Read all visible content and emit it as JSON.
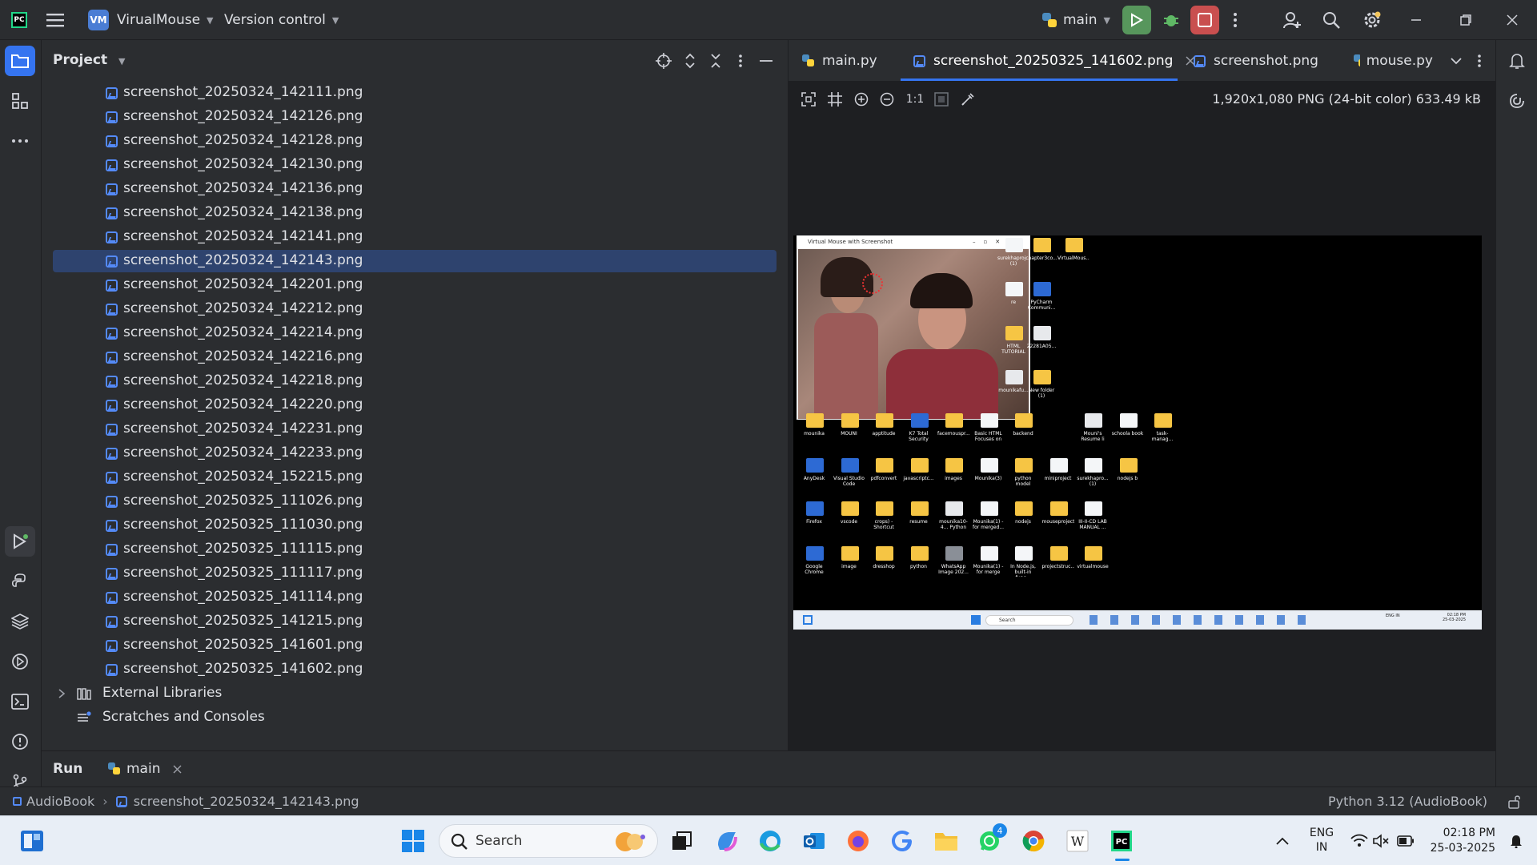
{
  "titlebar": {
    "project_badge": "VM",
    "project_name": "VirualMouse",
    "vcs": "Version control",
    "branch": "main"
  },
  "project_panel": {
    "title": "Project",
    "files": [
      "screenshot_20250324_142111.png",
      "screenshot_20250324_142126.png",
      "screenshot_20250324_142128.png",
      "screenshot_20250324_142130.png",
      "screenshot_20250324_142136.png",
      "screenshot_20250324_142138.png",
      "screenshot_20250324_142141.png",
      "screenshot_20250324_142143.png",
      "screenshot_20250324_142201.png",
      "screenshot_20250324_142212.png",
      "screenshot_20250324_142214.png",
      "screenshot_20250324_142216.png",
      "screenshot_20250324_142218.png",
      "screenshot_20250324_142220.png",
      "screenshot_20250324_142231.png",
      "screenshot_20250324_142233.png",
      "screenshot_20250324_152215.png",
      "screenshot_20250325_111026.png",
      "screenshot_20250325_111030.png",
      "screenshot_20250325_111115.png",
      "screenshot_20250325_111117.png",
      "screenshot_20250325_141114.png",
      "screenshot_20250325_141215.png",
      "screenshot_20250325_141601.png",
      "screenshot_20250325_141602.png"
    ],
    "selected_index": 7,
    "external_libraries": "External Libraries",
    "scratches": "Scratches and Consoles"
  },
  "tabs": [
    {
      "label": "main.py",
      "icon": "python-icon"
    },
    {
      "label": "screenshot_20250325_141602.png",
      "icon": "image-icon",
      "active": true
    },
    {
      "label": "screenshot.png",
      "icon": "image-icon"
    },
    {
      "label": "mouse.py",
      "icon": "python-icon"
    }
  ],
  "image_viewer": {
    "zoom_label": "1:1",
    "info": "1,920x1,080 PNG (24-bit color) 633.49 kB"
  },
  "preview": {
    "window_title": "Virtual Mouse with Screenshot",
    "search_label": "Search",
    "icons": [
      {
        "label": "surekhaproj... (1)",
        "kind": "doc"
      },
      {
        "label": "chapter3co...",
        "kind": "folder"
      },
      {
        "label": "VirtualMous...",
        "kind": "folder"
      },
      {
        "label": "re",
        "kind": "doc"
      },
      {
        "label": "PyCharm Communi...",
        "kind": "app"
      },
      {
        "label": "HTML TUTORIAL",
        "kind": "folder"
      },
      {
        "label": "22281A05...",
        "kind": "pdf"
      },
      {
        "label": "mounikafu...",
        "kind": "pdf"
      },
      {
        "label": "New folder (1)",
        "kind": "folder"
      },
      {
        "label": "mounika",
        "kind": "folder"
      },
      {
        "label": "MOUNI",
        "kind": "folder"
      },
      {
        "label": "apptitude",
        "kind": "folder"
      },
      {
        "label": "K7 Total Security",
        "kind": "app"
      },
      {
        "label": "facemouspr...",
        "kind": "folder"
      },
      {
        "label": "Basic HTML Focuses on ...",
        "kind": "doc"
      },
      {
        "label": "backend",
        "kind": "folder"
      },
      {
        "label": "Mouni's Resume li",
        "kind": "pdf"
      },
      {
        "label": "schoola book",
        "kind": "doc"
      },
      {
        "label": "task-manag...",
        "kind": "folder"
      },
      {
        "label": "AnyDesk",
        "kind": "app"
      },
      {
        "label": "Visual Studio Code",
        "kind": "app"
      },
      {
        "label": "pdfconvert",
        "kind": "folder"
      },
      {
        "label": "javascriptc...",
        "kind": "folder"
      },
      {
        "label": "images",
        "kind": "folder"
      },
      {
        "label": "Mounika(3)",
        "kind": "doc"
      },
      {
        "label": "python model",
        "kind": "folder"
      },
      {
        "label": "miniproject",
        "kind": "doc"
      },
      {
        "label": "surekhapro... (1)",
        "kind": "doc"
      },
      {
        "label": "nodejs b",
        "kind": "folder"
      },
      {
        "label": "Firefox",
        "kind": "app"
      },
      {
        "label": "vscode",
        "kind": "folder"
      },
      {
        "label": "crops) - Shortcut",
        "kind": "folder"
      },
      {
        "label": "resume",
        "kind": "folder"
      },
      {
        "label": "mounika10-4... Python",
        "kind": "pdf"
      },
      {
        "label": "Mounika(1) - for merged...",
        "kind": "doc"
      },
      {
        "label": "nodejs",
        "kind": "folder"
      },
      {
        "label": "mouseproject",
        "kind": "folder"
      },
      {
        "label": "III-II-CD LAB MANUAL ...",
        "kind": "doc"
      },
      {
        "label": "Google Chrome",
        "kind": "app"
      },
      {
        "label": "image",
        "kind": "folder"
      },
      {
        "label": "dresshop",
        "kind": "folder"
      },
      {
        "label": "python",
        "kind": "folder"
      },
      {
        "label": "WhatsApp Image 202...",
        "kind": "img"
      },
      {
        "label": "Mounika(1) - for merge",
        "kind": "doc"
      },
      {
        "label": "In Node.js, built-in func...",
        "kind": "doc"
      },
      {
        "label": "projectstruc...",
        "kind": "folder"
      },
      {
        "label": "virtualmouse",
        "kind": "folder"
      }
    ],
    "tray_lang": "ENG IN",
    "tray_time": "02:18 PM",
    "tray_date": "25-03-2025"
  },
  "run_bar": {
    "label": "Run",
    "config": "main"
  },
  "status_bar": {
    "breadcrumb_project": "AudioBook",
    "breadcrumb_file": "screenshot_20250324_142143.png",
    "interpreter": "Python 3.12 (AudioBook)"
  },
  "taskbar": {
    "search_placeholder": "Search",
    "lang_line1": "ENG",
    "lang_line2": "IN",
    "time": "02:18 PM",
    "date": "25-03-2025",
    "whatsapp_badge": "4"
  },
  "colors": {
    "accent": "#3574f0",
    "selection": "#2e436e",
    "panel": "#2b2d30",
    "editor_bg": "#1e1f22"
  }
}
